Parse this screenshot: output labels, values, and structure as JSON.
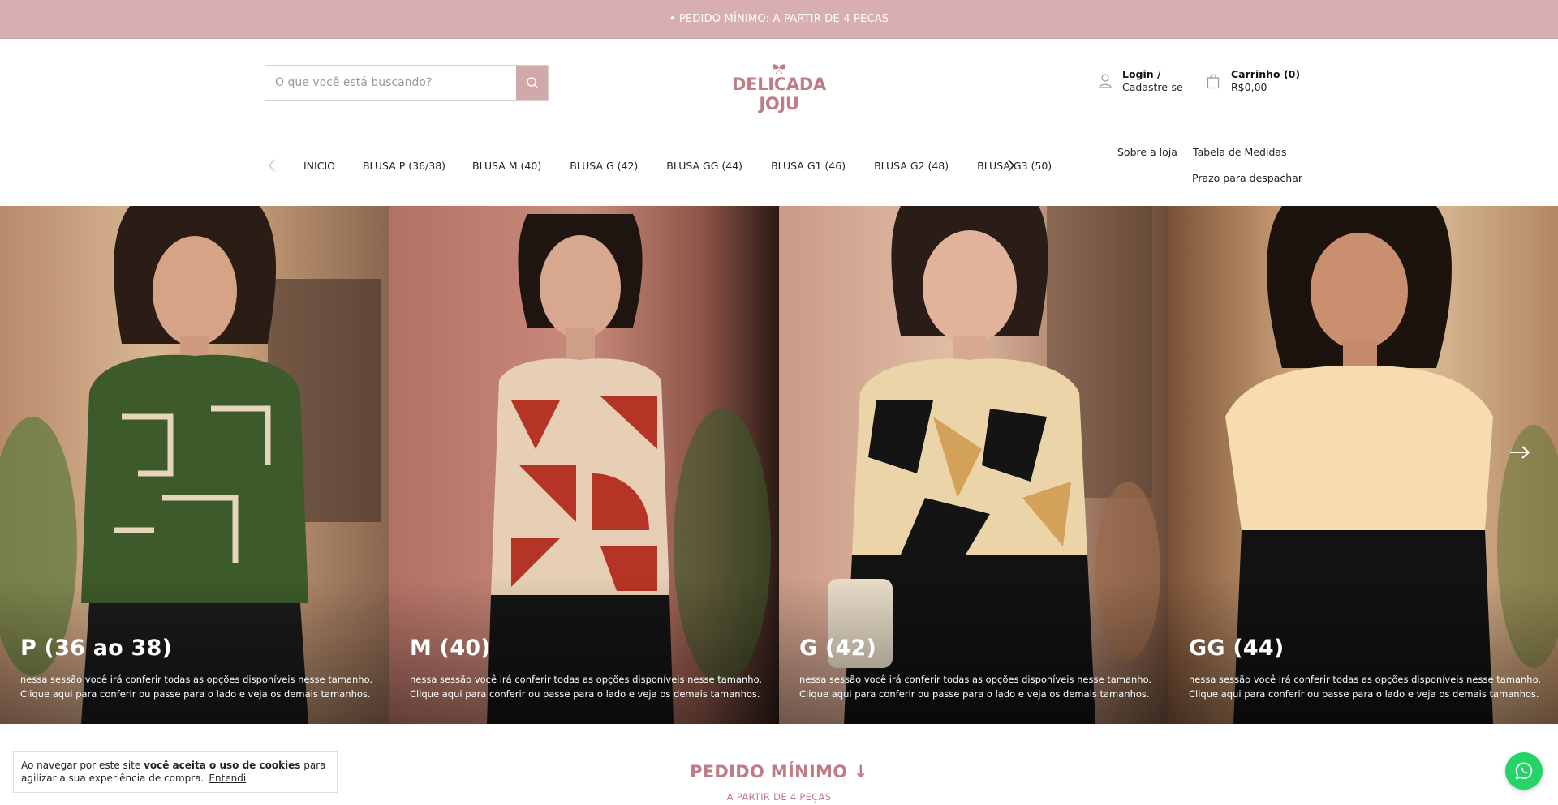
{
  "announcement": {
    "text": "• PEDIDO MÍNIMO: A PARTIR DE 4 PEÇAS"
  },
  "header": {
    "search": {
      "placeholder": "O que você está buscando?",
      "button_icon": "search-icon"
    },
    "logo": {
      "text": "DELICADA JOJU",
      "icon": "butterfly-icon",
      "color": "#c07c86"
    },
    "account": {
      "line1": "Login /",
      "line2": "Cadastre-se",
      "icon": "user-icon"
    },
    "cart": {
      "line1": "Carrinho (0)",
      "line2": "R$0,00",
      "icon": "shopping-bag-icon"
    }
  },
  "nav": {
    "items": [
      {
        "label": "INÍCIO"
      },
      {
        "label": "BLUSA P (36/38)"
      },
      {
        "label": "BLUSA M (40)"
      },
      {
        "label": "BLUSA G (42)"
      },
      {
        "label": "BLUSA GG (44)"
      },
      {
        "label": "BLUSA G1 (46)"
      },
      {
        "label": "BLUSA G2 (48)"
      },
      {
        "label": "BLUSA G3 (50)"
      }
    ],
    "side_links": [
      {
        "label": "Sobre a loja"
      },
      {
        "label": "Tabela de Medidas"
      },
      {
        "label": "Prazo para despachar"
      }
    ]
  },
  "hero": {
    "panels": [
      {
        "title": "P (36 ao 38)",
        "description": "nessa sessão você irá conferir todas as opções disponíveis nesse tamanho. Clique aqui para conferir ou passe para o lado e veja os demais tamanhos."
      },
      {
        "title": "M (40)",
        "description": "nessa sessão você irá conferir todas as opções disponíveis nesse tamanho. Clique aqui para conferir ou passe para o lado e veja os demais tamanhos."
      },
      {
        "title": "G (42)",
        "description": "nessa sessão você irá conferir todas as opções disponíveis nesse tamanho. Clique aqui para conferir ou passe para o lado e veja os demais tamanhos."
      },
      {
        "title": "GG (44)",
        "description": "nessa sessão você irá conferir todas as opções disponíveis nesse tamanho. Clique aqui para conferir ou passe para o lado e veja os demais tamanhos."
      }
    ]
  },
  "cookie_banner": {
    "text_before": "Ao navegar por este site ",
    "text_bold": "você aceita o uso de cookies",
    "text_after": " para agilizar a sua experiência de compra.",
    "accept_label": "Entendi"
  },
  "min_order": {
    "title": "PEDIDO MÍNIMO ↓",
    "subtitle": "A PARTIR DE 4 PEÇAS"
  },
  "colors": {
    "accent": "#d7aeb1",
    "brand": "#c07c86",
    "whatsapp": "#25d366"
  }
}
